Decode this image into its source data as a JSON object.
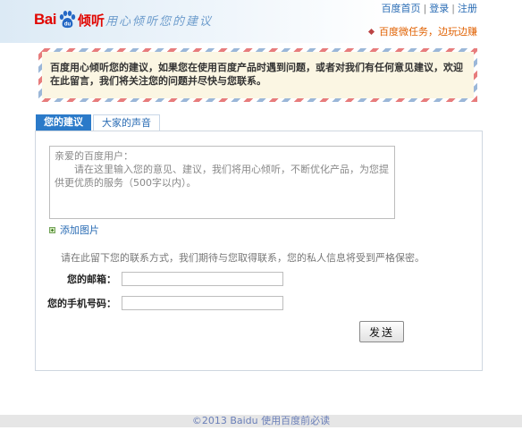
{
  "header": {
    "logo_bai": "Bai",
    "logo_ting": "倾听",
    "slogan": "用心倾听您的建议",
    "links": [
      "百度首页",
      "登录",
      "注册"
    ],
    "task": "百度微任务，边玩边赚"
  },
  "notice": {
    "text": "百度用心倾听您的建议，如果您在使用百度产品时遇到问题，或者对我们有任何意见建议，欢迎在此留言，我们将关注您的问题并尽快与您联系。"
  },
  "tabs": [
    {
      "label": "您的建议"
    },
    {
      "label": "大家的声音"
    }
  ],
  "form": {
    "textarea_greeting": "亲爱的百度用户：",
    "textarea_body": "请在这里输入您的意见、建议，我们将用心倾听，不断优化产品，为您提供更优质的服务（500字以内）。",
    "add_image": "添加图片",
    "hint": "请在此留下您的联系方式，我们期待与您取得联系，您的私人信息将受到严格保密。",
    "email_label": "您的邮箱：",
    "email_value": "",
    "phone_label": "您的手机号码：",
    "phone_value": "",
    "send_label": "发送"
  },
  "footer": {
    "text": "©2013 Baidu 使用百度前必读"
  },
  "colors": {
    "brand_red": "#e10601",
    "link_blue": "#2a6cb4",
    "tab_active": "#2b7ac9",
    "notice_bg": "#fbf6e3"
  }
}
